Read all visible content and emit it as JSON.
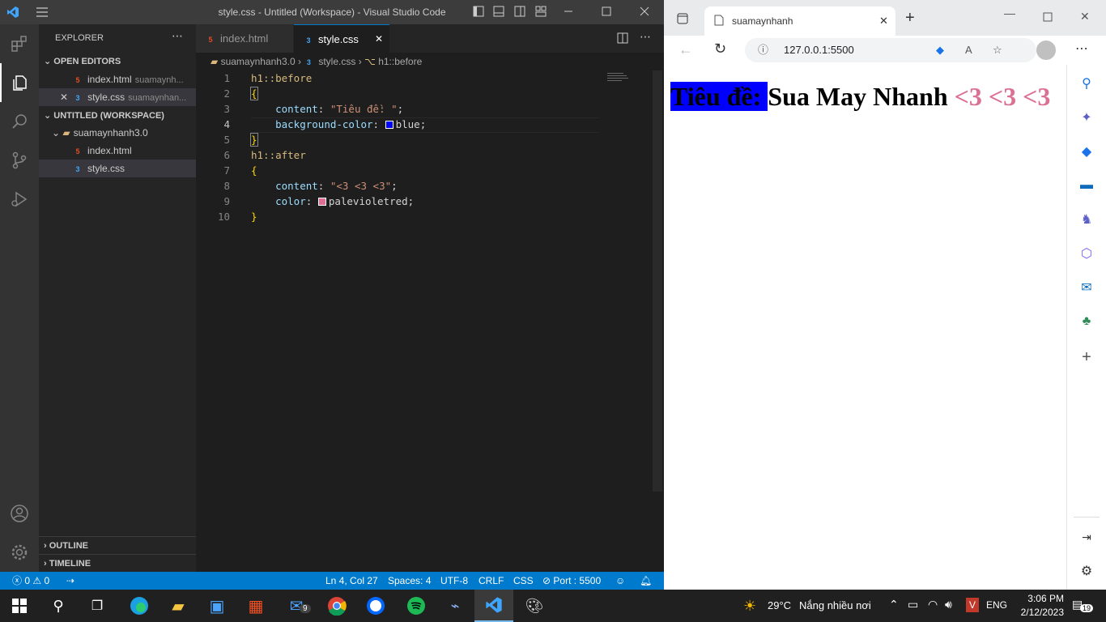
{
  "vscode": {
    "title": "style.css - Untitled (Workspace) - Visual Studio Code",
    "explorer_title": "EXPLORER",
    "open_editors_label": "OPEN EDITORS",
    "open_editors": [
      {
        "name": "index.html",
        "desc": "suamaynh..."
      },
      {
        "name": "style.css",
        "desc": "suamaynhan..."
      }
    ],
    "workspace_label": "UNTITLED (WORKSPACE)",
    "folder": "suamaynhanh3.0",
    "files": [
      "index.html",
      "style.css"
    ],
    "outline_label": "OUTLINE",
    "timeline_label": "TIMELINE",
    "tabs": [
      "index.html",
      "style.css"
    ],
    "breadcrumb": {
      "folder": "suamaynhanh3.0",
      "file": "style.css",
      "symbol": "h1::before"
    },
    "line_numbers": [
      "1",
      "2",
      "3",
      "4",
      "5",
      "6",
      "7",
      "8",
      "9",
      "10"
    ],
    "code": {
      "l1": "h1::before",
      "l2": "{",
      "l3_prop": "content",
      "l3_val": "\"Tiêu đề: \"",
      "l4_prop": "background-color",
      "l4_val": "blue",
      "l5": "}",
      "l6": "h1::after",
      "l7": "{",
      "l8_prop": "content",
      "l8_val": "\"<3 <3 <3\"",
      "l9_prop": "color",
      "l9_val": "palevioletred",
      "l10": "}"
    },
    "status": {
      "errors": "0",
      "warnings": "0",
      "position": "Ln 4, Col 27",
      "spaces": "Spaces: 4",
      "encoding": "UTF-8",
      "eol": "CRLF",
      "language": "CSS",
      "port": "Port : 5500"
    },
    "colors": {
      "accent": "#007acc",
      "blue_swatch": "#0000ff",
      "pvr_swatch": "#db7093"
    }
  },
  "edge": {
    "tab_title": "suamaynhanh",
    "url": "127.0.0.1:5500",
    "page": {
      "before": "Tiêu đề: ",
      "heading": "Sua May Nhanh",
      "after": "<3 <3 <3"
    }
  },
  "taskbar": {
    "weather_temp": "29°C",
    "weather_text": "Nắng nhiều nơi",
    "lang": "ENG",
    "time": "3:06 PM",
    "date": "2/12/2023",
    "notifications": "19",
    "mail_badge": "9"
  }
}
